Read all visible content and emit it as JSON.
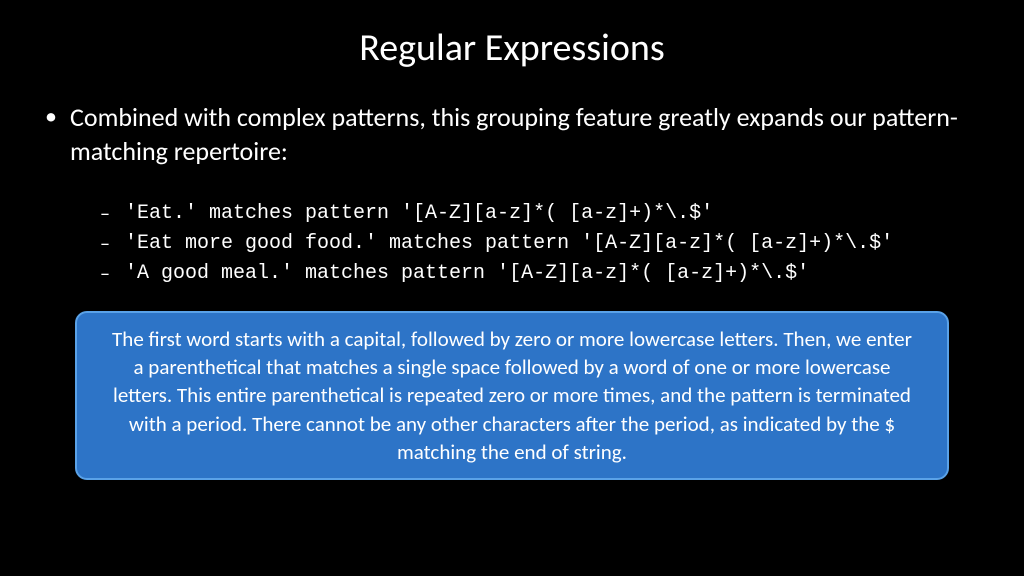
{
  "title": "Regular Expressions",
  "main_bullet": "Combined with complex patterns, this grouping feature greatly expands our pattern-matching repertoire:",
  "examples": [
    "'Eat.' matches pattern '[A-Z][a-z]*( [a-z]+)*\\.$'",
    "'Eat more good food.' matches pattern '[A-Z][a-z]*( [a-z]+)*\\.$'",
    "'A good meal.' matches pattern '[A-Z][a-z]*( [a-z]+)*\\.$'"
  ],
  "explanation": "The first word starts with a capital, followed by zero or more lowercase letters. Then, we enter a parenthetical that matches a single space followed by a word of one or more lowercase letters. This entire parenthetical is repeated zero or more times, and the pattern is terminated with a period. There cannot be any other characters after the period, as indicated by the $ matching the end of string."
}
